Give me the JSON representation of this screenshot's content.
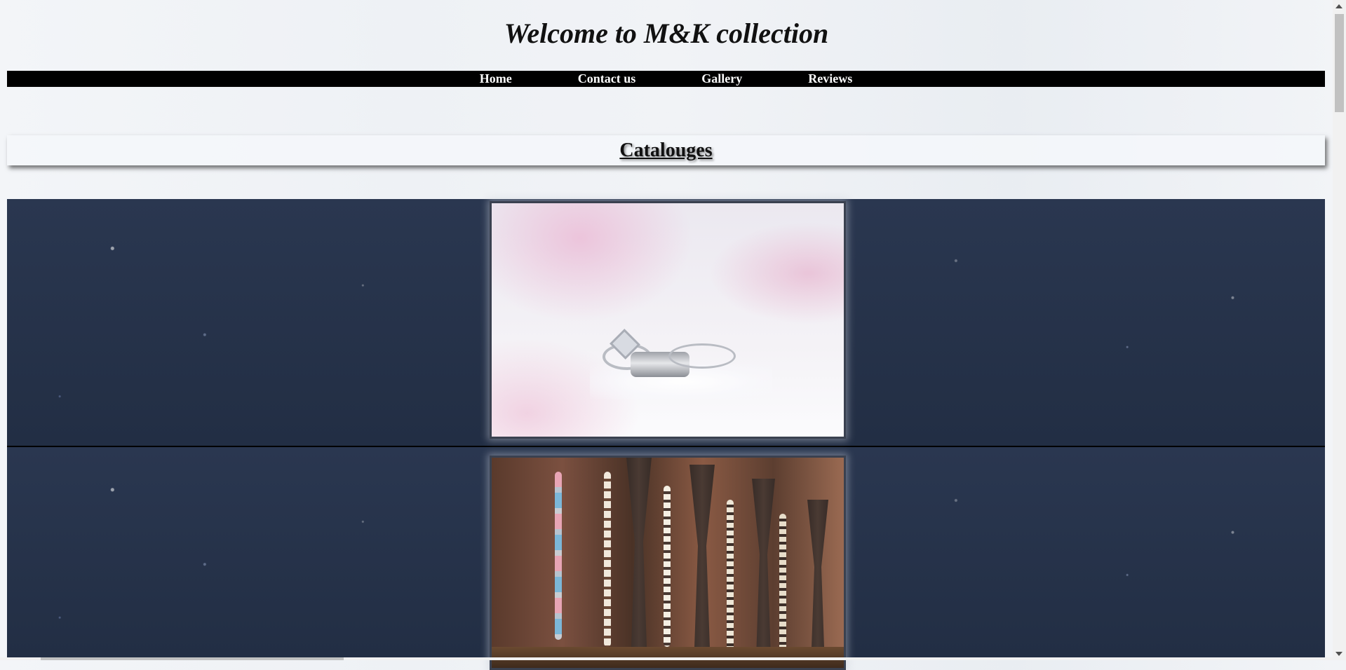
{
  "header": {
    "title": "Welcome to M&K collection"
  },
  "nav": {
    "items": [
      {
        "label": "Home"
      },
      {
        "label": "Contact us"
      },
      {
        "label": "Gallery"
      },
      {
        "label": "Reviews"
      }
    ]
  },
  "main": {
    "section_heading": "Catalouges",
    "catalog_images": [
      {
        "icon": "rings-photo"
      },
      {
        "icon": "necklaces-photo"
      }
    ]
  },
  "colors": {
    "nav_background": "#000000",
    "nav_text": "#ffffff",
    "row_background": "#26334a"
  }
}
